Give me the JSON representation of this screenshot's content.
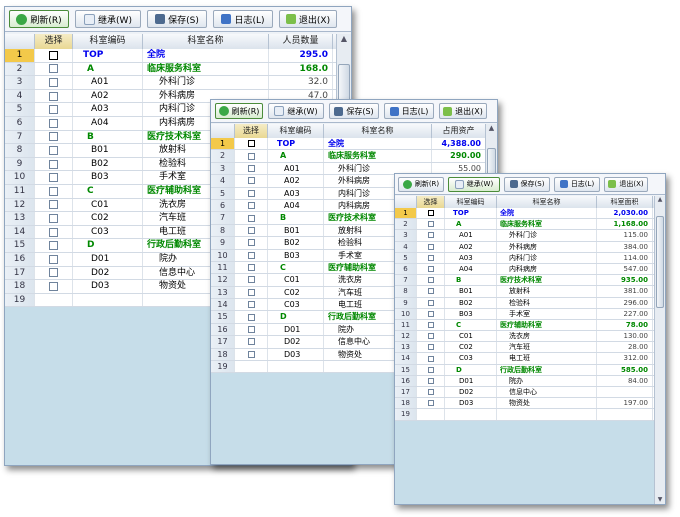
{
  "toolbar": {
    "refresh": "刷新(R)",
    "inherit": "继承(W)",
    "save": "保存(S)",
    "log": "日志(L)",
    "exit": "退出(X)"
  },
  "columns": {
    "rownum": "",
    "select": "选择",
    "code": "科室编码",
    "name": "科室名称"
  },
  "value_headers": {
    "w1": "人员数量",
    "w2": "占用资产",
    "w3": "科室面积"
  },
  "rows": [
    {
      "n": "1",
      "code": "TOP",
      "name": "全院",
      "type": "top"
    },
    {
      "n": "2",
      "code": "A",
      "name": "临床服务科室",
      "type": "cat"
    },
    {
      "n": "3",
      "code": "A01",
      "name": "外科门诊",
      "type": "item"
    },
    {
      "n": "4",
      "code": "A02",
      "name": "外科病房",
      "type": "item"
    },
    {
      "n": "5",
      "code": "A03",
      "name": "内科门诊",
      "type": "item"
    },
    {
      "n": "6",
      "code": "A04",
      "name": "内科病房",
      "type": "item"
    },
    {
      "n": "7",
      "code": "B",
      "name": "医疗技术科室",
      "type": "cat"
    },
    {
      "n": "8",
      "code": "B01",
      "name": "放射科",
      "type": "item"
    },
    {
      "n": "9",
      "code": "B02",
      "name": "检验科",
      "type": "item"
    },
    {
      "n": "10",
      "code": "B03",
      "name": "手术室",
      "type": "item"
    },
    {
      "n": "11",
      "code": "C",
      "name": "医疗辅助科室",
      "type": "cat"
    },
    {
      "n": "12",
      "code": "C01",
      "name": "洗衣房",
      "type": "item"
    },
    {
      "n": "13",
      "code": "C02",
      "name": "汽车班",
      "type": "item"
    },
    {
      "n": "14",
      "code": "C03",
      "name": "电工班",
      "type": "item"
    },
    {
      "n": "15",
      "code": "D",
      "name": "行政后勤科室",
      "type": "cat"
    },
    {
      "n": "16",
      "code": "D01",
      "name": "院办",
      "type": "item"
    },
    {
      "n": "17",
      "code": "D02",
      "name": "信息中心",
      "type": "item"
    },
    {
      "n": "18",
      "code": "D03",
      "name": "物资处",
      "type": "item"
    },
    {
      "n": "19",
      "code": "",
      "name": "",
      "type": "empty"
    }
  ],
  "values": {
    "w1": [
      "295.0",
      "168.0",
      "32.0",
      "47.0",
      "",
      "",
      "",
      "",
      "",
      "",
      "",
      "",
      "",
      "",
      "",
      "",
      "",
      "",
      ""
    ],
    "w2": [
      "4,388.00",
      "290.00",
      "55.00",
      "",
      "",
      "",
      "",
      "",
      "",
      "",
      "",
      "",
      "",
      "",
      "",
      "",
      "",
      "",
      ""
    ],
    "w3": [
      "2,030.00",
      "1,168.00",
      "115.00",
      "384.00",
      "114.00",
      "547.00",
      "935.00",
      "381.00",
      "296.00",
      "227.00",
      "78.00",
      "130.00",
      "28.00",
      "312.00",
      "585.00",
      "84.00",
      "",
      "197.00",
      ""
    ]
  },
  "colors": {
    "top_text": "#0000ee",
    "category_text": "#008800",
    "selected_row": "#f3c94a",
    "empty_area": "#c6dde9"
  },
  "icons": [
    "refresh-icon",
    "inherit-icon",
    "save-icon",
    "log-icon",
    "exit-icon"
  ]
}
